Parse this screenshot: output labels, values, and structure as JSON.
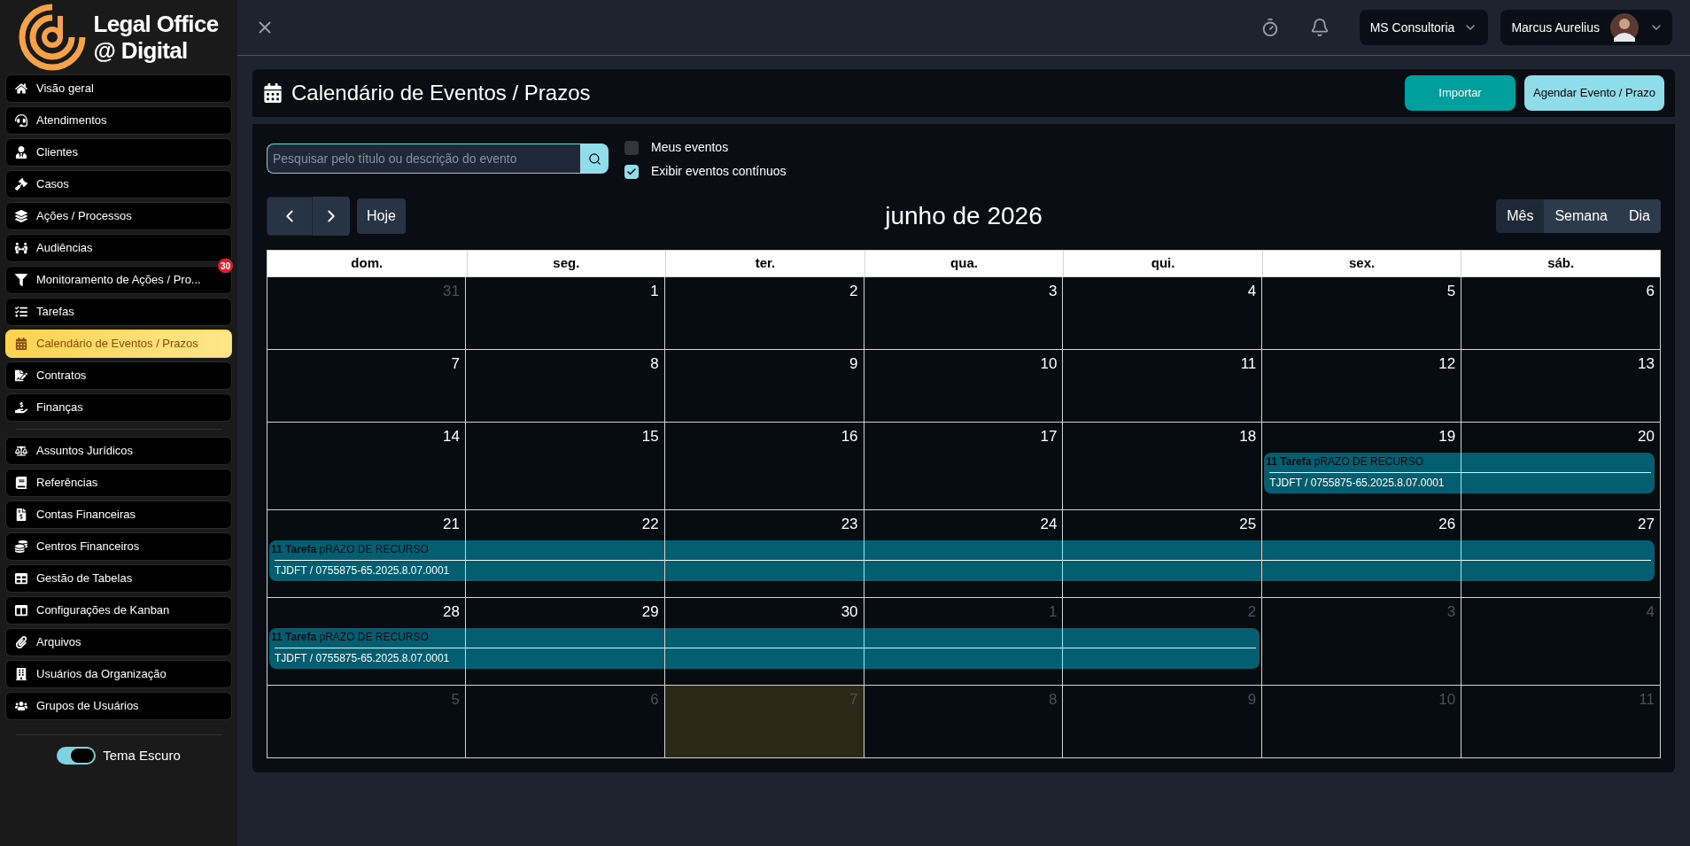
{
  "logo": {
    "line_1": "Legal Office",
    "line_2": "@ Digital"
  },
  "sidebar": {
    "groups": [
      [
        {
          "label": "Visão geral",
          "selected": false
        },
        {
          "label": "Atendimentos",
          "selected": false
        },
        {
          "label": "Clientes",
          "selected": false
        },
        {
          "label": "Casos",
          "selected": false
        },
        {
          "label": "Ações / Processos",
          "selected": false
        },
        {
          "label": "Audiências",
          "selected": false
        },
        {
          "label": "Monitoramento de Ações / Pro...",
          "selected": false,
          "badge": "30"
        },
        {
          "label": "Tarefas",
          "selected": false
        },
        {
          "label": "Calendário de Eventos / Prazos",
          "selected": true
        },
        {
          "label": "Contratos",
          "selected": false
        },
        {
          "label": "Finanças",
          "selected": false
        }
      ],
      [
        {
          "label": "Assuntos Jurídicos",
          "selected": false
        },
        {
          "label": "Referências",
          "selected": false
        },
        {
          "label": "Contas Financeiras",
          "selected": false
        },
        {
          "label": "Centros Financeiros",
          "selected": false
        },
        {
          "label": "Gestão de Tabelas",
          "selected": false
        },
        {
          "label": "Configurações de Kanban",
          "selected": false
        },
        {
          "label": "Arquivos",
          "selected": false
        },
        {
          "label": "Usuários da Organização",
          "selected": false
        },
        {
          "label": "Grupos de Usuários",
          "selected": false
        }
      ]
    ],
    "theme_toggle": {
      "label": "Tema Escuro",
      "on": true
    }
  },
  "topbar": {
    "organization": "MS Consultoria",
    "user": "Marcus Aurelius"
  },
  "page": {
    "title": "Calendário de Eventos / Prazos",
    "buttons": [
      "Importar",
      "Agendar Evento / Prazo"
    ]
  },
  "search": {
    "placeholder": "Pesquisar pelo título ou descrição do evento"
  },
  "filters": [
    {
      "label": "Meus eventos",
      "checked": false
    },
    {
      "label": "Exibir eventos contínuos",
      "checked": true
    }
  ],
  "nav": {
    "today": "Hoje"
  },
  "month_title": "junho de 2026",
  "views": [
    {
      "label": "Mês",
      "selected": true
    },
    {
      "label": "Semana",
      "selected": false
    },
    {
      "label": "Dia",
      "selected": false
    }
  ],
  "weekdays": [
    "dom.",
    "seg.",
    "ter.",
    "qua.",
    "qui.",
    "sex.",
    "sáb."
  ],
  "weeks": [
    {
      "days": [
        {
          "label": "31",
          "other_month": true,
          "today": false,
          "in_event": false
        },
        {
          "label": "1",
          "other_month": false,
          "today": false,
          "in_event": false
        },
        {
          "label": "2",
          "other_month": false,
          "today": false,
          "in_event": false
        },
        {
          "label": "3",
          "other_month": false,
          "today": false,
          "in_event": false
        },
        {
          "label": "4",
          "other_month": false,
          "today": false,
          "in_event": false
        },
        {
          "label": "5",
          "other_month": false,
          "today": false,
          "in_event": false
        },
        {
          "label": "6",
          "other_month": false,
          "today": false,
          "in_event": false
        }
      ]
    },
    {
      "days": [
        {
          "label": "7",
          "other_month": false,
          "today": false,
          "in_event": false
        },
        {
          "label": "8",
          "other_month": false,
          "today": false,
          "in_event": false
        },
        {
          "label": "9",
          "other_month": false,
          "today": false,
          "in_event": false
        },
        {
          "label": "10",
          "other_month": false,
          "today": false,
          "in_event": false
        },
        {
          "label": "11",
          "other_month": false,
          "today": false,
          "in_event": false
        },
        {
          "label": "12",
          "other_month": false,
          "today": false,
          "in_event": false
        },
        {
          "label": "13",
          "other_month": false,
          "today": false,
          "in_event": false
        }
      ]
    },
    {
      "days": [
        {
          "label": "14",
          "other_month": false,
          "today": false,
          "in_event": false
        },
        {
          "label": "15",
          "other_month": false,
          "today": false,
          "in_event": false
        },
        {
          "label": "16",
          "other_month": false,
          "today": false,
          "in_event": false
        },
        {
          "label": "17",
          "other_month": false,
          "today": false,
          "in_event": false
        },
        {
          "label": "18",
          "other_month": false,
          "today": false,
          "in_event": false
        },
        {
          "label": "19",
          "other_month": false,
          "today": false,
          "in_event": true
        },
        {
          "label": "20",
          "other_month": false,
          "today": false,
          "in_event": true
        }
      ],
      "event": {
        "title": "**11 Tarefa** pRAZO DE RECURSO",
        "detail": "TJDFT / 0755875-65.2025.8.07.0001"
      }
    },
    {
      "days": [
        {
          "label": "21",
          "other_month": false,
          "today": false,
          "in_event": true
        },
        {
          "label": "22",
          "other_month": false,
          "today": false,
          "in_event": true
        },
        {
          "label": "23",
          "other_month": false,
          "today": false,
          "in_event": true
        },
        {
          "label": "24",
          "other_month": false,
          "today": false,
          "in_event": true
        },
        {
          "label": "25",
          "other_month": false,
          "today": false,
          "in_event": true
        },
        {
          "label": "26",
          "other_month": false,
          "today": false,
          "in_event": true
        },
        {
          "label": "27",
          "other_month": false,
          "today": false,
          "in_event": true
        }
      ],
      "event": {
        "title": "**11 Tarefa** pRAZO DE RECURSO",
        "detail": "TJDFT / 0755875-65.2025.8.07.0001"
      }
    },
    {
      "days": [
        {
          "label": "28",
          "other_month": false,
          "today": false,
          "in_event": true
        },
        {
          "label": "29",
          "other_month": false,
          "today": false,
          "in_event": true
        },
        {
          "label": "30",
          "other_month": false,
          "today": false,
          "in_event": true
        },
        {
          "label": "1",
          "other_month": true,
          "today": false,
          "in_event": true
        },
        {
          "label": "2",
          "other_month": true,
          "today": false,
          "in_event": true
        },
        {
          "label": "3",
          "other_month": true,
          "today": false,
          "in_event": false
        },
        {
          "label": "4",
          "other_month": true,
          "today": false,
          "in_event": false
        }
      ],
      "event": {
        "title": "**11 Tarefa** pRAZO DE RECURSO",
        "detail": "TJDFT / 0755875-65.2025.8.07.0001"
      }
    },
    {
      "days": [
        {
          "label": "5",
          "other_month": true,
          "today": false,
          "in_event": false
        },
        {
          "label": "6",
          "other_month": true,
          "today": false,
          "in_event": false
        },
        {
          "label": "7",
          "other_month": true,
          "today": true,
          "in_event": false
        },
        {
          "label": "8",
          "other_month": true,
          "today": false,
          "in_event": false
        },
        {
          "label": "9",
          "other_month": true,
          "today": false,
          "in_event": false
        },
        {
          "label": "10",
          "other_month": true,
          "today": false,
          "in_event": false
        },
        {
          "label": "11",
          "other_month": true,
          "today": false,
          "in_event": false
        }
      ]
    }
  ]
}
